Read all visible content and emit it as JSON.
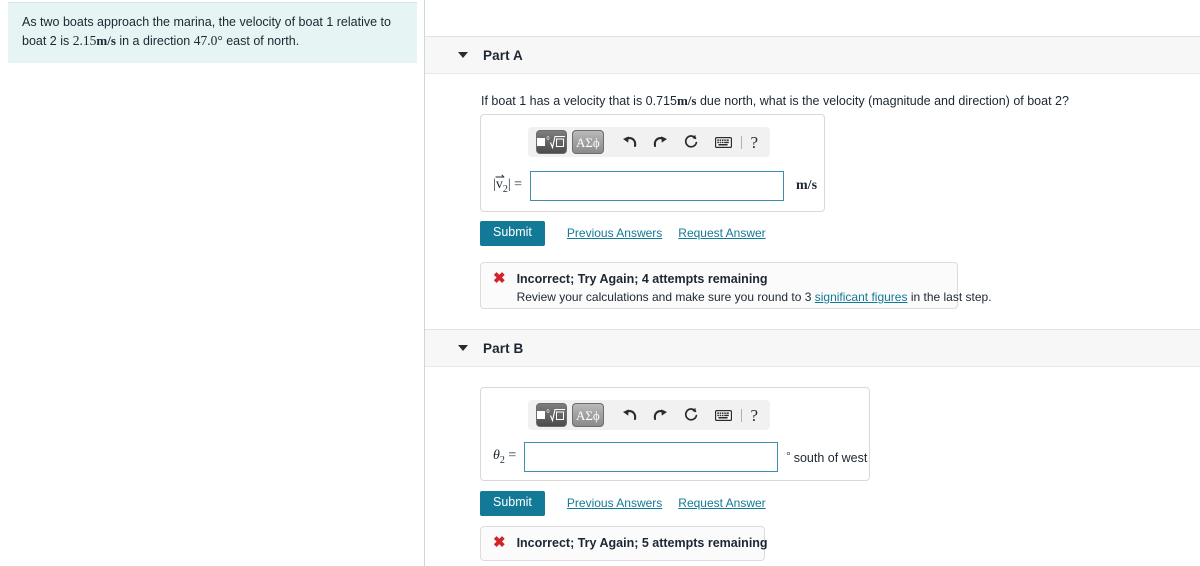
{
  "problem": {
    "text_lead": "As two boats approach the marina, the velocity of boat 1 relative to boat 2 is",
    "value": "2.15",
    "unit": "m/s",
    "text_mid": "in a direction",
    "angle": "47.0",
    "degree_symbol": "°",
    "text_tail": "east of north."
  },
  "math_toolbar": {
    "template_button_name": "nth-root-template",
    "greek_button_label": "ΑΣϕ",
    "undo_label": "undo",
    "redo_label": "redo",
    "reset_label": "reset",
    "keyboard_label": "keyboard",
    "help_label": "?"
  },
  "parts": [
    {
      "id": "part-a",
      "title": "Part A",
      "caret": "▼",
      "prompt_before": "If boat 1 has a velocity that is 0.715",
      "prompt_unit": "m/s",
      "prompt_after": "due north, what is the velocity (magnitude and direction) of boat 2?",
      "answer_label": "|v⃗2| =",
      "answer_value": "",
      "answer_placeholder": "",
      "answer_unit": "m/s",
      "answer_suffix": "",
      "submit_label": "Submit",
      "previous_answers_label": "Previous Answers",
      "request_answer_label": "Request Answer",
      "feedback": {
        "icon": "✖",
        "title": "Incorrect; Try Again; 4 attempts remaining",
        "sub_before": "Review your calculations and make sure you round to 3",
        "sub_link": "significant figures",
        "sub_after": "in the last step."
      }
    },
    {
      "id": "part-b",
      "title": "Part B",
      "caret": "▼",
      "prompt_before": "",
      "prompt_unit": "",
      "prompt_after": "",
      "answer_label": "θ2 =",
      "answer_value": "",
      "answer_placeholder": "",
      "answer_unit": "",
      "answer_suffix": "south of west",
      "submit_label": "Submit",
      "previous_answers_label": "Previous Answers",
      "request_answer_label": "Request Answer",
      "feedback": {
        "icon": "✖",
        "title": "Incorrect; Try Again; 5 attempts remaining",
        "sub_before": "",
        "sub_link": "",
        "sub_after": ""
      }
    }
  ],
  "colors": {
    "accent_teal": "#127a97",
    "input_border": "#3d90ab",
    "problem_bg": "#e6f4f3",
    "header_bg": "#f7f7f7",
    "error_red": "#d3222a"
  }
}
